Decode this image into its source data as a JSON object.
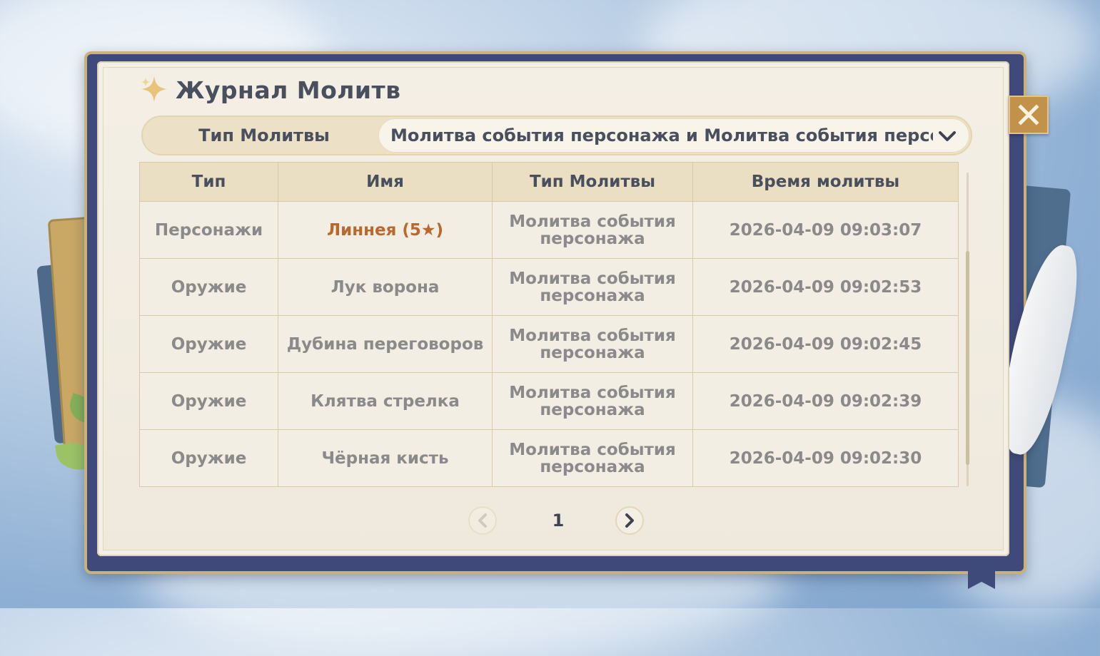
{
  "header": {
    "title": "Журнал Молитв"
  },
  "filter": {
    "label": "Тип Молитвы",
    "selected": "Молитва события персонажа и Молитва события персо…"
  },
  "table": {
    "columns": [
      "Тип",
      "Имя",
      "Тип Молитвы",
      "Время молитвы"
    ],
    "rows": [
      {
        "type": "Персонажи",
        "name": "Линнея (5★)",
        "banner": "Молитва события персонажа",
        "time": "2026-04-09 09:03:07"
      },
      {
        "type": "Оружие",
        "name": "Лук ворона",
        "banner": "Молитва события персонажа",
        "time": "2026-04-09 09:02:53"
      },
      {
        "type": "Оружие",
        "name": "Дубина переговоров",
        "banner": "Молитва события персонажа",
        "time": "2026-04-09 09:02:45"
      },
      {
        "type": "Оружие",
        "name": "Клятва стрелка",
        "banner": "Молитва события персонажа",
        "time": "2026-04-09 09:02:39"
      },
      {
        "type": "Оружие",
        "name": "Чёрная кисть",
        "banner": "Молитва события персонажа",
        "time": "2026-04-09 09:02:30"
      }
    ]
  },
  "pagination": {
    "current_page": "1"
  },
  "icons": {
    "title": "sparkle-icon",
    "close": "close-icon",
    "dropdown": "chevron-down-icon",
    "prev": "chevron-left-icon",
    "next": "chevron-right-icon"
  },
  "colors": {
    "five_star": "#b9692e",
    "text_dark": "#4a4f5d",
    "text_muted": "#8a8a8a",
    "header_bg": "#ebdfc3",
    "close_bg": "#c2924b"
  }
}
